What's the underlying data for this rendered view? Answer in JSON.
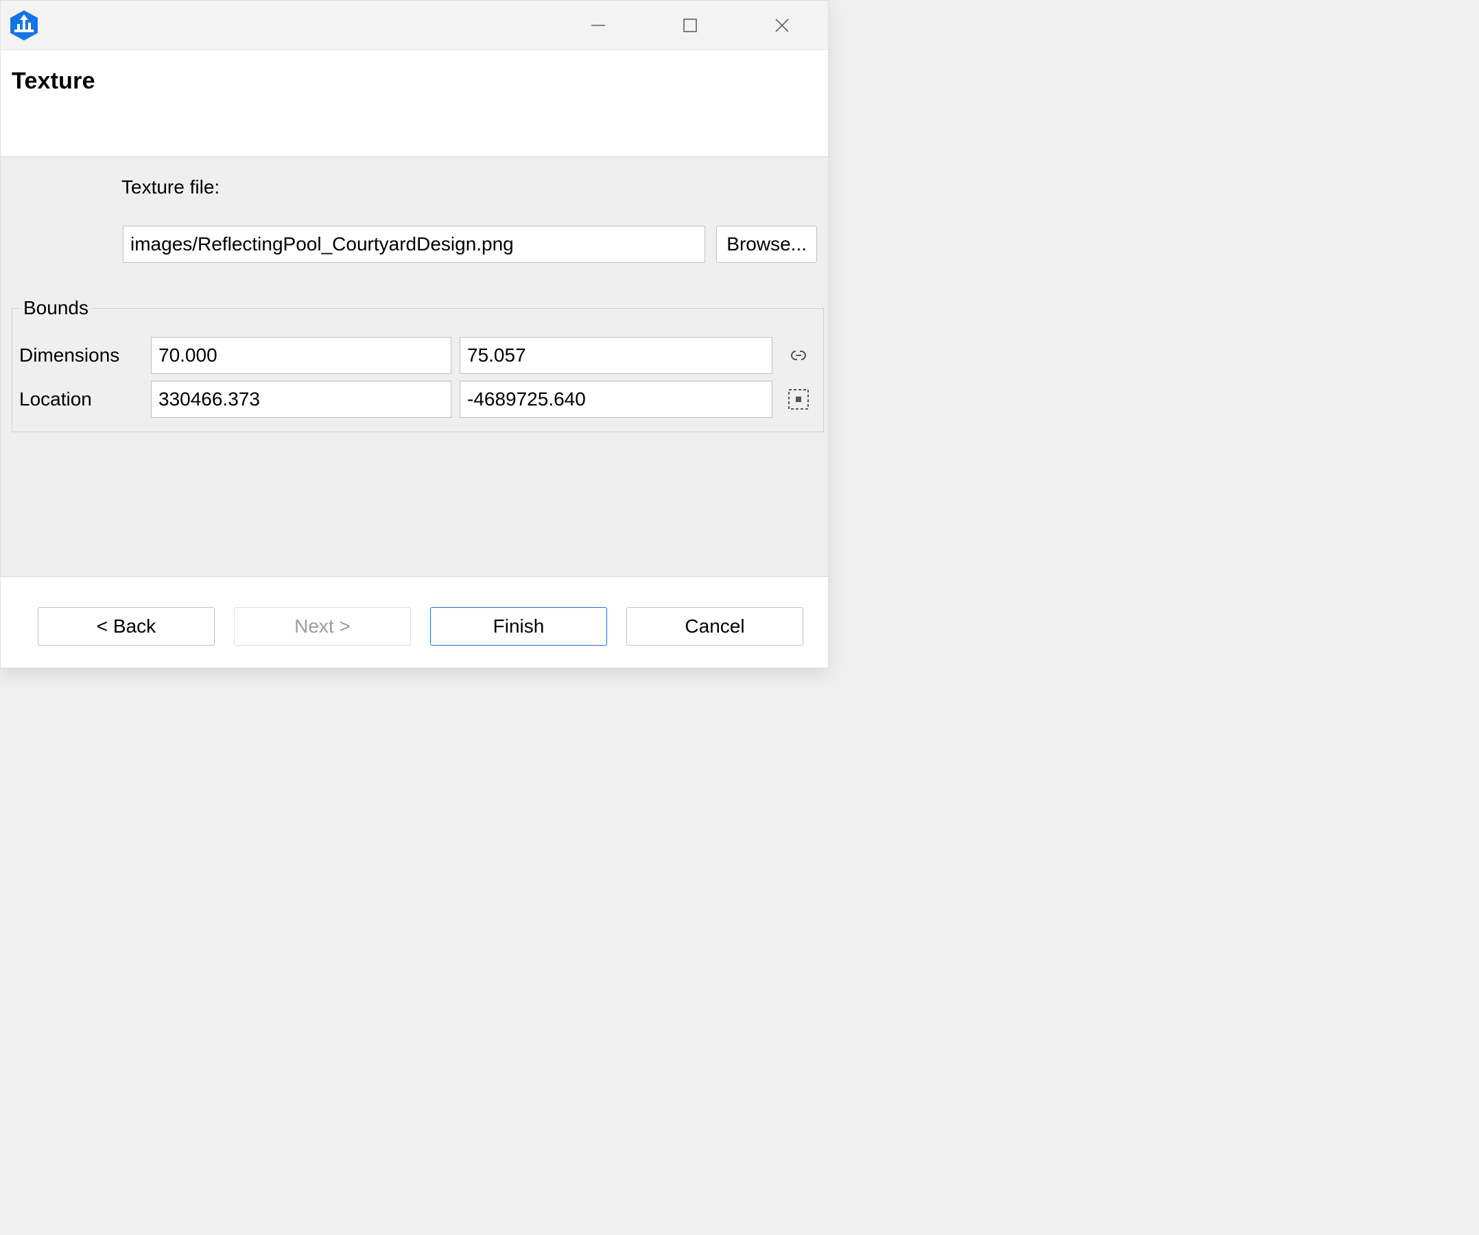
{
  "header": {
    "title": "Texture"
  },
  "fields": {
    "texture_file_label": "Texture file:",
    "texture_file_value": "images/ReflectingPool_CourtyardDesign.png",
    "browse_label": "Browse..."
  },
  "bounds": {
    "legend": "Bounds",
    "dimensions_label": "Dimensions",
    "dim_x": "70.000",
    "dim_y": "75.057",
    "location_label": "Location",
    "loc_x": "330466.373",
    "loc_y": "-4689725.640"
  },
  "buttons": {
    "back": "< Back",
    "next": "Next >",
    "finish": "Finish",
    "cancel": "Cancel"
  }
}
